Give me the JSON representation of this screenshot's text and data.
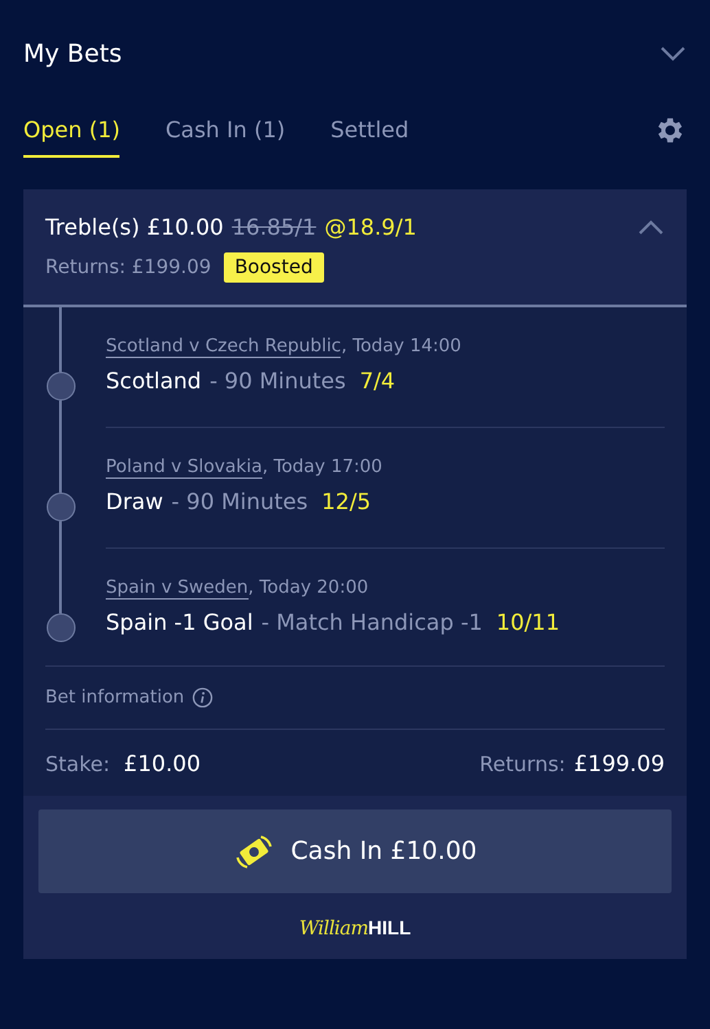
{
  "header": {
    "title": "My Bets"
  },
  "tabs": [
    {
      "label": "Open (1)",
      "selected": true
    },
    {
      "label": "Cash In (1)",
      "selected": false
    },
    {
      "label": "Settled",
      "selected": false
    }
  ],
  "bet": {
    "type_stake": "Treble(s) £10.00",
    "original_odds": "16.85/1",
    "boosted_odds": "@18.9/1",
    "expanded": true,
    "returns": "Returns: £199.09",
    "badge": "Boosted",
    "legs": [
      {
        "event": "Scotland v Czech Republic",
        "time": ", Today 14:00",
        "selection": "Scotland",
        "market": "- 90 Minutes",
        "odds": "7/4"
      },
      {
        "event": "Poland v Slovakia",
        "time": ", Today 17:00",
        "selection": "Draw",
        "market": "- 90 Minutes",
        "odds": "12/5"
      },
      {
        "event": "Spain v Sweden",
        "time": ", Today 20:00",
        "selection": "Spain -1 Goal",
        "market": "- Match Handicap -1",
        "odds": "10/11"
      }
    ],
    "info_label": "Bet information",
    "stake_label": "Stake:",
    "stake": "£10.00",
    "returns_label": "Returns:",
    "returns_value": "£199.09",
    "cash_in_button": "Cash In £10.00"
  },
  "logo": {
    "script": "William",
    "wordmark": "HILL"
  }
}
